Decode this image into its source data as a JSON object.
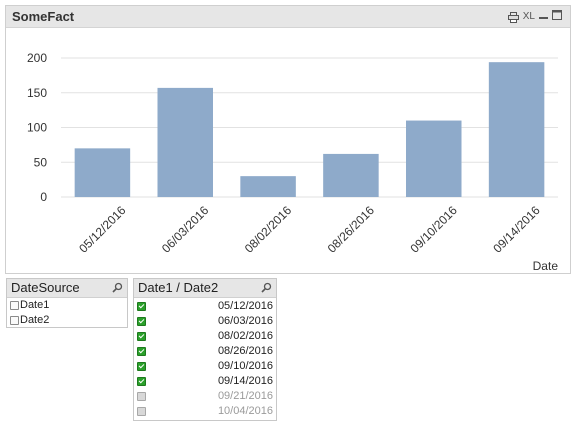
{
  "chart_panel": {
    "title": "SomeFact",
    "icons": [
      "print-icon",
      "xl-export-icon",
      "minimize-icon",
      "maximize-icon"
    ],
    "xl_label": "XL"
  },
  "chart_data": {
    "type": "bar",
    "categories": [
      "05/12/2016",
      "06/03/2016",
      "08/02/2016",
      "08/26/2016",
      "09/10/2016",
      "09/14/2016"
    ],
    "values": [
      70,
      157,
      30,
      62,
      110,
      194
    ],
    "xlabel": "Date",
    "ylabel": "",
    "ylim": [
      0,
      200
    ],
    "yticks": [
      0,
      50,
      100,
      150,
      200
    ],
    "grid": true,
    "bar_color": "#8eaaca",
    "grid_color": "#e2e2e2"
  },
  "date_source": {
    "title": "DateSource",
    "items": [
      {
        "label": "Date1",
        "checked": false
      },
      {
        "label": "Date2",
        "checked": false
      }
    ]
  },
  "date_list": {
    "title": "Date1 / Date2",
    "items": [
      {
        "label": "05/12/2016",
        "state": "selected"
      },
      {
        "label": "06/03/2016",
        "state": "selected"
      },
      {
        "label": "08/02/2016",
        "state": "selected"
      },
      {
        "label": "08/26/2016",
        "state": "selected"
      },
      {
        "label": "09/10/2016",
        "state": "selected"
      },
      {
        "label": "09/14/2016",
        "state": "selected"
      },
      {
        "label": "09/21/2016",
        "state": "excluded"
      },
      {
        "label": "10/04/2016",
        "state": "excluded"
      }
    ]
  },
  "colors": {
    "selected_green": "#2aa02a",
    "excluded_grey": "#9a9a9a",
    "caption_bg": "#e6e6e6"
  }
}
